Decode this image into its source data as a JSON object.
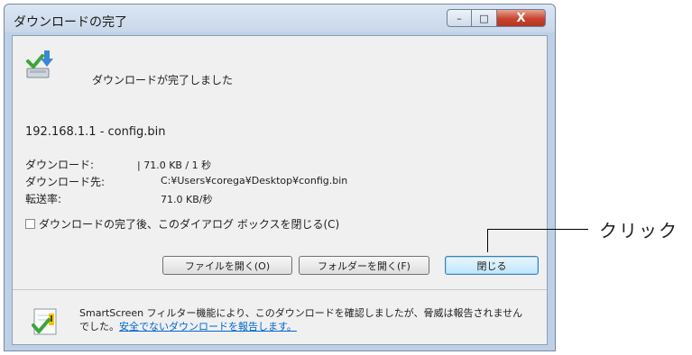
{
  "window": {
    "title": "ダウンロードの完了",
    "controls": {
      "minimize": "–",
      "maximize": "□",
      "close": "X"
    }
  },
  "header": {
    "icon": "download-complete-icon",
    "message": "ダウンロードが完了しました"
  },
  "file": {
    "name": "192.168.1.1 - config.bin"
  },
  "details": [
    {
      "label": "ダウンロード:",
      "value": "| 71.0 KB / 1 秒"
    },
    {
      "label": "ダウンロード先:",
      "value": "C:¥Users¥corega¥Desktop¥config.bin"
    },
    {
      "label": "転送率:",
      "value": "71.0 KB/秒"
    }
  ],
  "close_on_complete": {
    "label": "ダウンロードの完了後、このダイアログ ボックスを閉じる(C)",
    "checked": false
  },
  "buttons": {
    "open_file": "ファイルを開く(O)",
    "open_folder": "フォルダーを開く(F)",
    "close": "閉じる"
  },
  "smartscreen": {
    "icon": "shield-check-icon",
    "text": "SmartScreen フィルター機能により、このダウンロードを確認しましたが、脅威は報告されませんでした。",
    "link": "安全でないダウンロードを報告します。"
  },
  "annotation": {
    "label": "クリック"
  }
}
